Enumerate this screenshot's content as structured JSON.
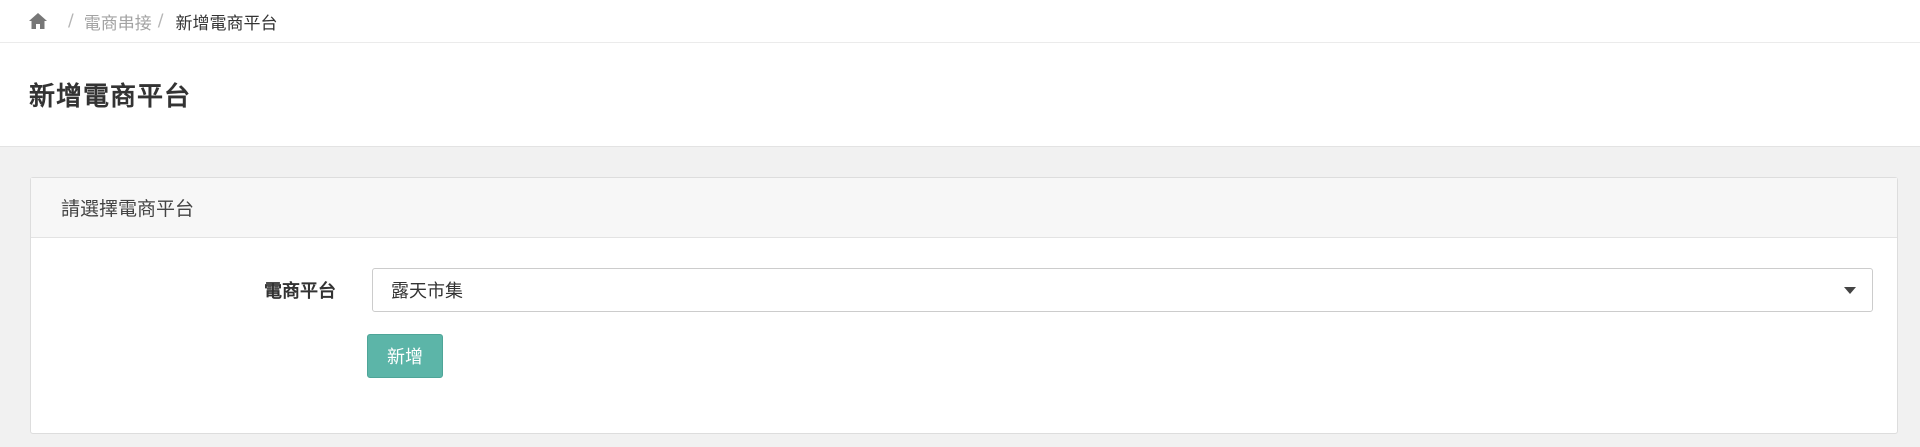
{
  "breadcrumb": {
    "home_icon": "home-icon",
    "separator": "/",
    "parent": "電商串接",
    "current": "新增電商平台"
  },
  "page": {
    "title": "新增電商平台"
  },
  "panel": {
    "heading": "請選擇電商平台",
    "form": {
      "platform_label": "電商平台",
      "platform_selected": "露天市集",
      "dropdown_icon": "chevron-down-icon"
    },
    "add_button_label": "新增"
  },
  "colors": {
    "accent": "#5cb5a8",
    "background": "#f1f1f1",
    "panel_heading_bg": "#f7f7f7"
  }
}
